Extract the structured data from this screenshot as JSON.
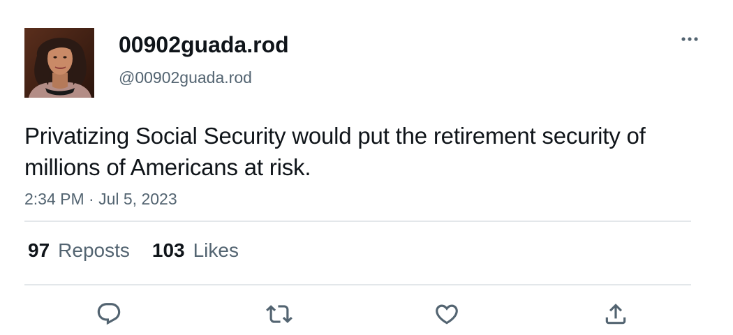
{
  "author": {
    "display_name": "00902guada.rod",
    "handle": "@00902guada.rod",
    "avatar_icon": "user-photo-avatar"
  },
  "menu": {
    "more_icon": "more-horizontal-icon"
  },
  "tweet": {
    "text": "Privatizing Social Security would put the retirement security of millions of Americans at risk.",
    "timestamp": "2:34 PM · Jul 5, 2023"
  },
  "stats": {
    "reposts_count": "97",
    "reposts_label": "Reposts",
    "likes_count": "103",
    "likes_label": "Likes"
  },
  "actions": {
    "reply_icon": "reply-icon",
    "repost_icon": "repost-icon",
    "like_icon": "like-icon",
    "share_icon": "share-icon"
  },
  "colors": {
    "text_primary": "#0f1419",
    "text_secondary": "#536471",
    "divider": "#e3e7ea",
    "icon": "#536471"
  }
}
